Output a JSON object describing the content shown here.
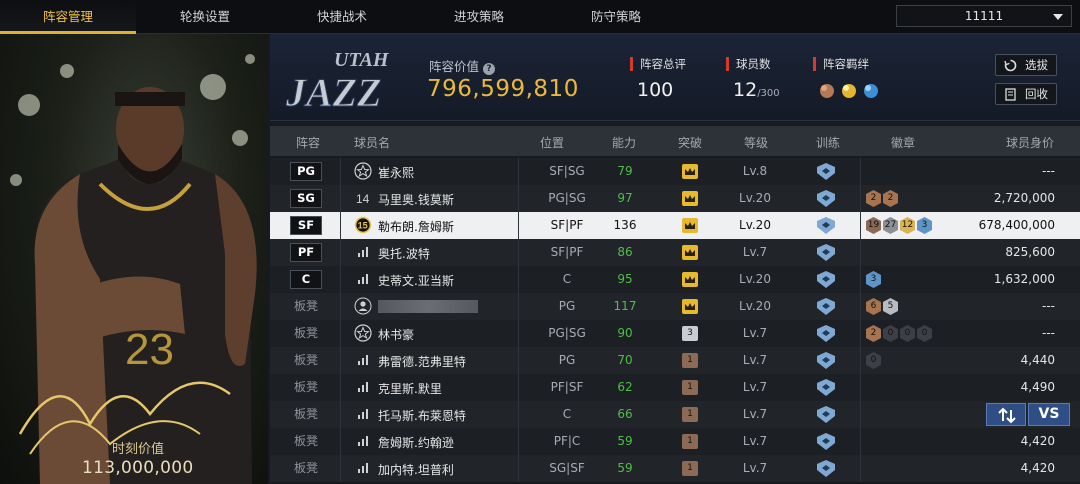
{
  "tabs": [
    {
      "label": "阵容管理",
      "active": true
    },
    {
      "label": "轮换设置",
      "active": false
    },
    {
      "label": "快捷战术",
      "active": false
    },
    {
      "label": "进攻策略",
      "active": false
    },
    {
      "label": "防守策略",
      "active": false
    }
  ],
  "team_select": {
    "value": "11111",
    "icon": "chevron-down-icon"
  },
  "card": {
    "jersey_number": "23",
    "value_label": "时刻价值",
    "value": "113,000,000"
  },
  "team": {
    "logo_top": "UTAH",
    "logo_bottom": "JAZZ",
    "lineup_value_label": "阵容价值",
    "lineup_value": "796,599,810",
    "overall_label": "阵容总评",
    "overall_value": "100",
    "player_count_label": "球员数",
    "player_count": "12",
    "player_count_max": "/300",
    "chemistry_label": "阵容羁绊"
  },
  "actions": {
    "select_label": "选拔",
    "recycle_label": "回收"
  },
  "table": {
    "headers": {
      "lineup": "阵容",
      "name": "球员名",
      "position": "位置",
      "ability": "能力",
      "breakthrough": "突破",
      "level": "等级",
      "training": "训练",
      "badges": "徽章",
      "worth": "球员身价"
    },
    "rows": [
      {
        "slot": "PG",
        "name": "崔永熙",
        "position": "SF|SG",
        "ability": "79",
        "level": "Lv.8",
        "worth": "---",
        "icon": "star-icon",
        "brk": "crown",
        "badges": [],
        "selected": false
      },
      {
        "slot": "SG",
        "name": "马里奥.钱莫斯",
        "position": "PG|SG",
        "ability": "97",
        "level": "Lv.20",
        "worth": "2,720,000",
        "icon": "number-14-icon",
        "brk": "crown",
        "badges": [
          "2",
          "2"
        ],
        "selected": false
      },
      {
        "slot": "SF",
        "name": "勒布朗.詹姆斯",
        "position": "SF|PF",
        "ability": "136",
        "level": "Lv.20",
        "worth": "678,400,000",
        "icon": "number-15-icon",
        "brk": "crown",
        "badges": [
          "19",
          "27",
          "12",
          "3"
        ],
        "selected": true
      },
      {
        "slot": "PF",
        "name": "奥托.波特",
        "position": "SF|PF",
        "ability": "86",
        "level": "Lv.7",
        "worth": "825,600",
        "icon": "bars-icon",
        "brk": "crown",
        "badges": [],
        "selected": false
      },
      {
        "slot": "C",
        "name": "史蒂文.亚当斯",
        "position": "C",
        "ability": "95",
        "level": "Lv.20",
        "worth": "1,632,000",
        "icon": "bars-icon",
        "brk": "crown",
        "badges": [
          "3"
        ],
        "selected": false
      },
      {
        "slot": "板凳",
        "name": "",
        "position": "PG",
        "ability": "117",
        "level": "Lv.20",
        "worth": "---",
        "icon": "person-icon",
        "brk": "crown",
        "badges": [
          "6",
          "5"
        ],
        "selected": false
      },
      {
        "slot": "板凳",
        "name": "林书豪",
        "position": "PG|SG",
        "ability": "90",
        "level": "Lv.7",
        "worth": "---",
        "icon": "star-icon",
        "brk": "3",
        "badges": [
          "2",
          "0",
          "0",
          "0"
        ],
        "selected": false
      },
      {
        "slot": "板凳",
        "name": "弗雷德.范弗里特",
        "position": "PG",
        "ability": "70",
        "level": "Lv.7",
        "worth": "4,440",
        "icon": "bars-icon",
        "brk": "1",
        "badges": [
          "0"
        ],
        "selected": false
      },
      {
        "slot": "板凳",
        "name": "克里斯.默里",
        "position": "PF|SF",
        "ability": "62",
        "level": "Lv.7",
        "worth": "4,490",
        "icon": "bars-icon",
        "brk": "1",
        "badges": [],
        "selected": false
      },
      {
        "slot": "板凳",
        "name": "托马斯.布莱恩特",
        "position": "C",
        "ability": "66",
        "level": "Lv.7",
        "worth": "",
        "icon": "bars-icon",
        "brk": "1",
        "badges": [],
        "selected": false
      },
      {
        "slot": "板凳",
        "name": "詹姆斯.约翰逊",
        "position": "PF|C",
        "ability": "59",
        "level": "Lv.7",
        "worth": "4,420",
        "icon": "bars-icon",
        "brk": "1",
        "badges": [],
        "selected": false
      },
      {
        "slot": "板凳",
        "name": "加内特.坦普利",
        "position": "SG|SF",
        "ability": "59",
        "level": "Lv.7",
        "worth": "4,420",
        "icon": "bars-icon",
        "brk": "1",
        "badges": [],
        "selected": false
      }
    ]
  },
  "row_actions": {
    "swap_icon": "swap-icon",
    "vs_label": "VS"
  },
  "colors": {
    "accent": "#eab93b",
    "ability_green": "#4fbf47",
    "tab_active": "#f3c23a",
    "stat_marker": "#d33b2c"
  }
}
